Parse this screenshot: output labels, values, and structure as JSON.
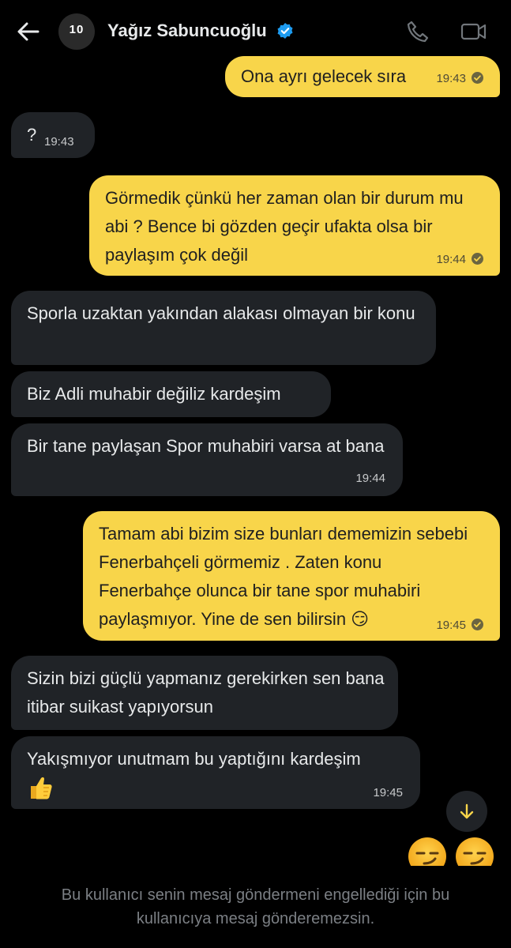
{
  "header": {
    "back_icon": "arrow-left-icon",
    "avatar_text": "10",
    "name": "Yağız Sabuncuoğlu",
    "verified_icon": "verified-badge-icon",
    "phone_icon": "phone-icon",
    "video_icon": "video-camera-icon"
  },
  "messages": [
    {
      "from": "me",
      "text": "Ona ayrı gelecek sıra",
      "time": "19:43",
      "read": true
    },
    {
      "from": "them",
      "text": "?",
      "time": "19:43"
    },
    {
      "from": "me",
      "text": "Görmedik çünkü her zaman olan bir durum mu abi ? Bence bi gözden geçir ufakta olsa bir paylaşım çok değil",
      "time": "19:44",
      "read": true
    },
    {
      "from": "them",
      "text": "Sporla uzaktan yakından alakası olmayan bir konu"
    },
    {
      "from": "them",
      "text": "Biz Adli muhabir değiliz kardeşim"
    },
    {
      "from": "them",
      "text": "Bir tane paylaşan Spor muhabiri varsa at bana",
      "time": "19:44"
    },
    {
      "from": "me",
      "text": "Tamam abi bizim size bunları dememizin sebebi Fenerbahçeli görmemiz . Zaten konu Fenerbahçe olunca bir tane spor muhabiri paylaşmıyor. Yine de sen bilirsin 😏",
      "time": "19:45",
      "read": true
    },
    {
      "from": "them",
      "text": "Sizin bizi güçlü yapmanız gerekirken sen bana itibar suikast yapıyorsun"
    },
    {
      "from": "them",
      "text": "Yakışmıyor unutmam bu yaptığını kardeşim",
      "emoji": "👍",
      "time": "19:45"
    }
  ],
  "scroll_down_icon": "arrow-down-icon",
  "reactions": [
    "😏",
    "😏"
  ],
  "footer": {
    "notice": "Bu kullanıcı senin mesaj göndermeni engellediği için bu kullanıcıya mesaj gönderemezsin."
  },
  "colors": {
    "background": "#000000",
    "incoming_bubble": "#202327",
    "outgoing_bubble": "#f8d54a",
    "verified": "#1d9bf0"
  }
}
